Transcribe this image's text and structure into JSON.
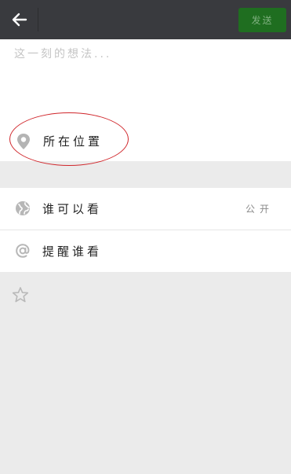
{
  "header": {
    "send_label": "发送",
    "back_icon": "arrow-left-icon",
    "colors": {
      "bar": "#393a3e",
      "send_bg": "#1f6e20",
      "send_text": "#7fb07f"
    }
  },
  "compose": {
    "placeholder": "这一刻的想法..."
  },
  "location": {
    "label": "所在位置",
    "icon": "location-pin-icon",
    "highlight_color": "#d0262b"
  },
  "visibility": {
    "label": "谁可以看",
    "value": "公开",
    "icon": "globe-icon"
  },
  "mention": {
    "label": "提醒谁看",
    "icon": "at-icon"
  },
  "footer": {
    "icon": "star-icon"
  }
}
